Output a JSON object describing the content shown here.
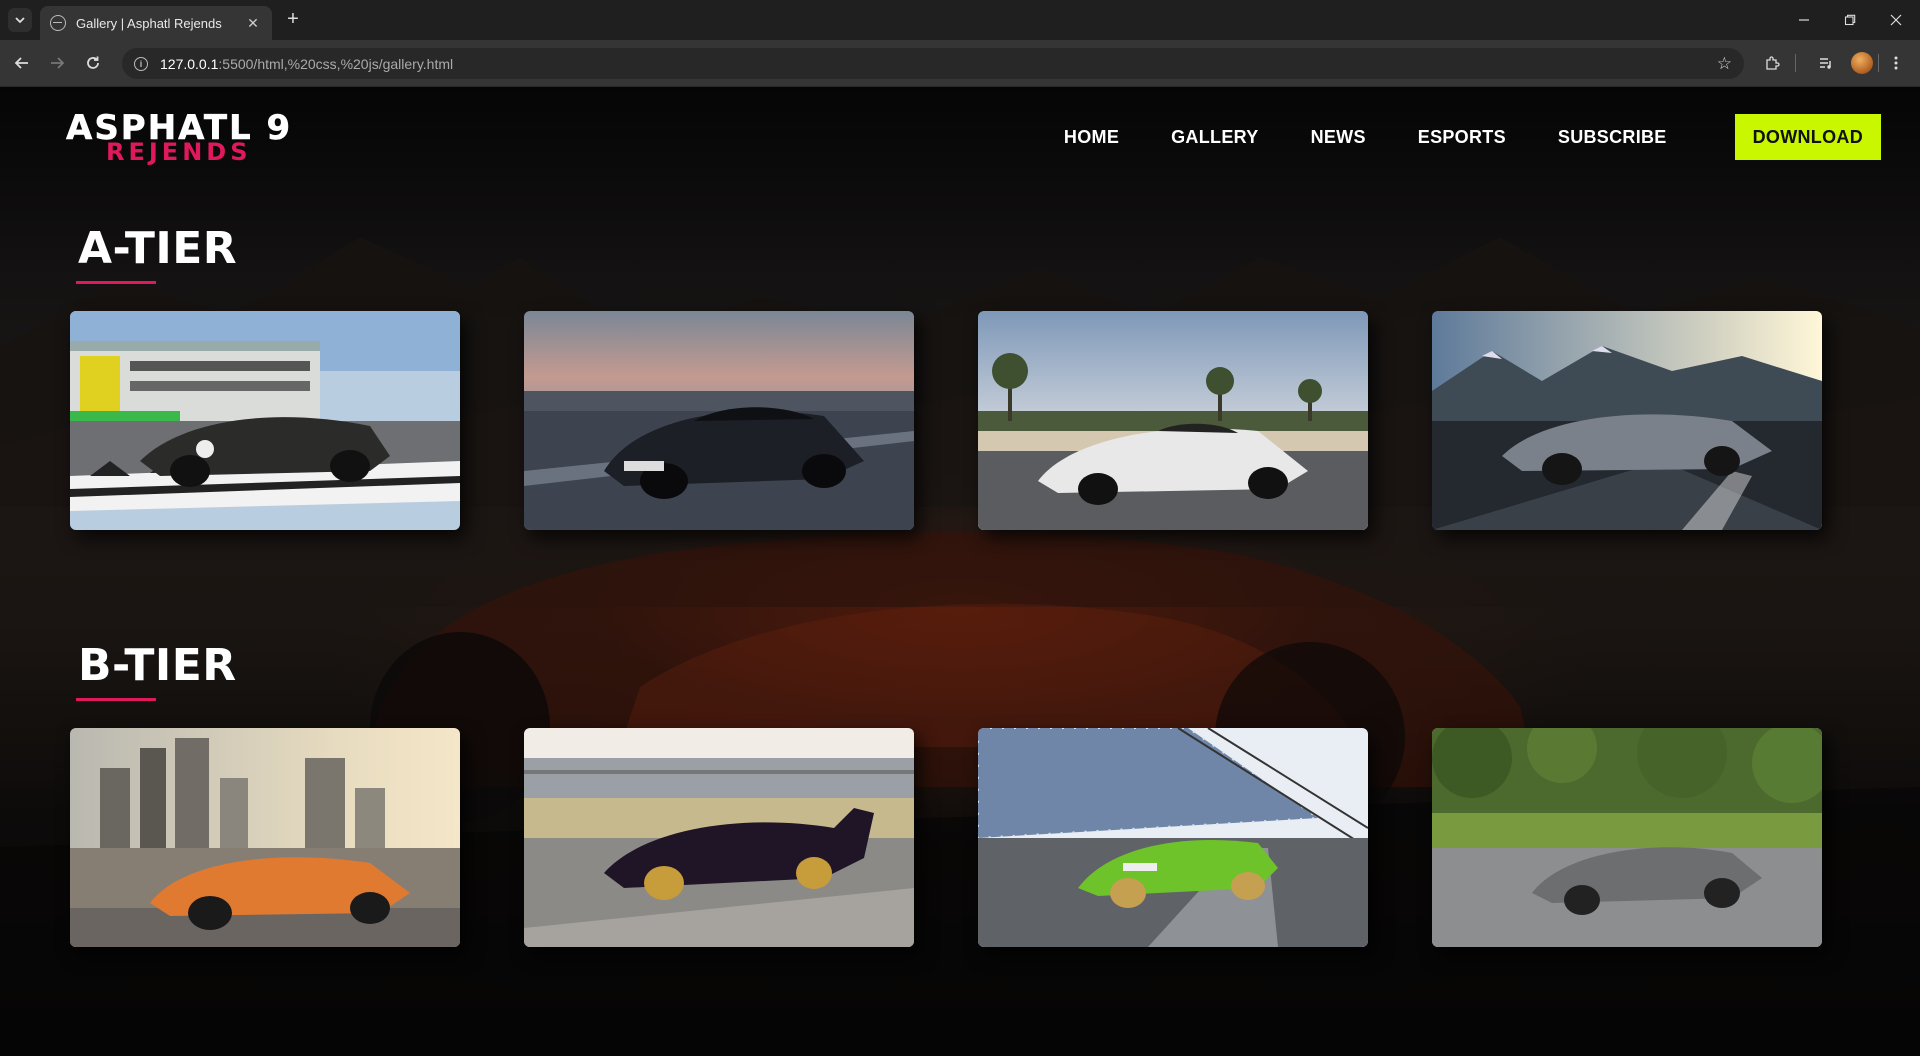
{
  "browser": {
    "tab_title": "Gallery | Asphatl Rejends",
    "url_host": "127.0.0.1",
    "url_path": ":5500/html,%20css,%20js/gallery.html"
  },
  "site": {
    "logo": {
      "line1": "ASPHATL 9",
      "line2": "REJENDS"
    },
    "nav": [
      "HOME",
      "GALLERY",
      "NEWS",
      "ESPORTS",
      "SUBSCRIBE"
    ],
    "cta": "DOWNLOAD",
    "colors": {
      "accent_pink": "#e0185c",
      "cta_lime": "#c8f700"
    }
  },
  "tiers": [
    {
      "title": "A-TIER",
      "cards": [
        {
          "scene": "racetrack-checkered",
          "car_color": "#2b2c2a"
        },
        {
          "scene": "dusk-road",
          "car_color": "#1c1f26"
        },
        {
          "scene": "palm-road",
          "car_color": "#e8e8e8"
        },
        {
          "scene": "mountain-sunset",
          "car_color": "#7b818a"
        }
      ]
    },
    {
      "title": "B-TIER",
      "cards": [
        {
          "scene": "city-skyline",
          "car_color": "#e07a30"
        },
        {
          "scene": "track-grandstand",
          "car_color": "#1f1526"
        },
        {
          "scene": "track-fence",
          "car_color": "#6ec22a"
        },
        {
          "scene": "forest-road",
          "car_color": "#6c6e70"
        }
      ]
    }
  ]
}
